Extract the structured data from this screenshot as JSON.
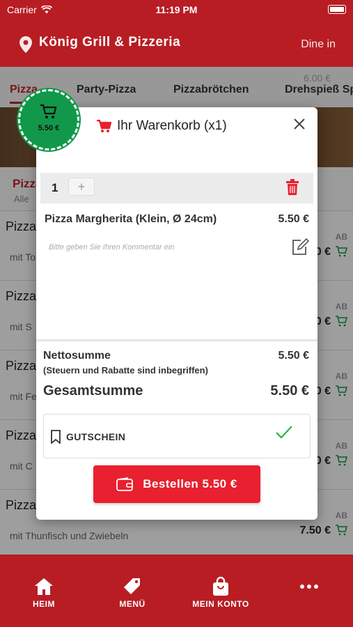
{
  "status": {
    "carrier": "Carrier",
    "time": "11:19 PM"
  },
  "header": {
    "title": "König Grill & Pizzeria",
    "mode": "Dine in"
  },
  "tabs": [
    "Pizza",
    "Party-Pizza",
    "Pizzabrötchen",
    "Drehspieß Sp"
  ],
  "cart_peek": "6.00 €",
  "category": {
    "name": "Pizza",
    "sub": "Alle"
  },
  "products": [
    {
      "name": "Pizza",
      "desc": "mit To",
      "ab": "AB",
      "price": "0 €"
    },
    {
      "name": "Pizza",
      "desc": "mit S",
      "ab": "AB",
      "price": "0 €"
    },
    {
      "name": "Pizza",
      "desc": "mit Fe",
      "ab": "AB",
      "price": "0 €"
    },
    {
      "name": "Pizza",
      "desc": "mit C",
      "ab": "AB",
      "price": "0 €"
    },
    {
      "name": "Pizza",
      "desc": "mit Thunfisch und Zwiebeln",
      "ab": "AB",
      "price": "7.50 €"
    }
  ],
  "badge": {
    "value": "5.50 €"
  },
  "cart": {
    "title": "Ihr Warenkorb (x1)",
    "quantity": "1",
    "plus": "+",
    "item_name": "Pizza Margherita (Klein, Ø 24cm)",
    "item_price": "5.50 €",
    "comment_placeholder": "Bitte geben Sie Ihren Kommentar ein",
    "net_label": "Nettosumme",
    "net_value": "5.50 €",
    "tax_note": "(Steuern und Rabatte sind inbegriffen)",
    "total_label": "Gesamtsumme",
    "total_value": "5.50 €",
    "voucher_label": "GUTSCHEIN",
    "order_button": "Bestellen 5.50 €"
  },
  "nav": [
    {
      "label": "HEIM",
      "icon": "home-icon"
    },
    {
      "label": "MENÜ",
      "icon": "tag-icon"
    },
    {
      "label": "MEIN KONTO",
      "icon": "bag-icon"
    },
    {
      "label": "",
      "icon": "more-icon"
    }
  ],
  "colors": {
    "brand": "#b81d24",
    "accent": "#e8202f",
    "badge": "#12984a",
    "check": "#2bb24c"
  }
}
